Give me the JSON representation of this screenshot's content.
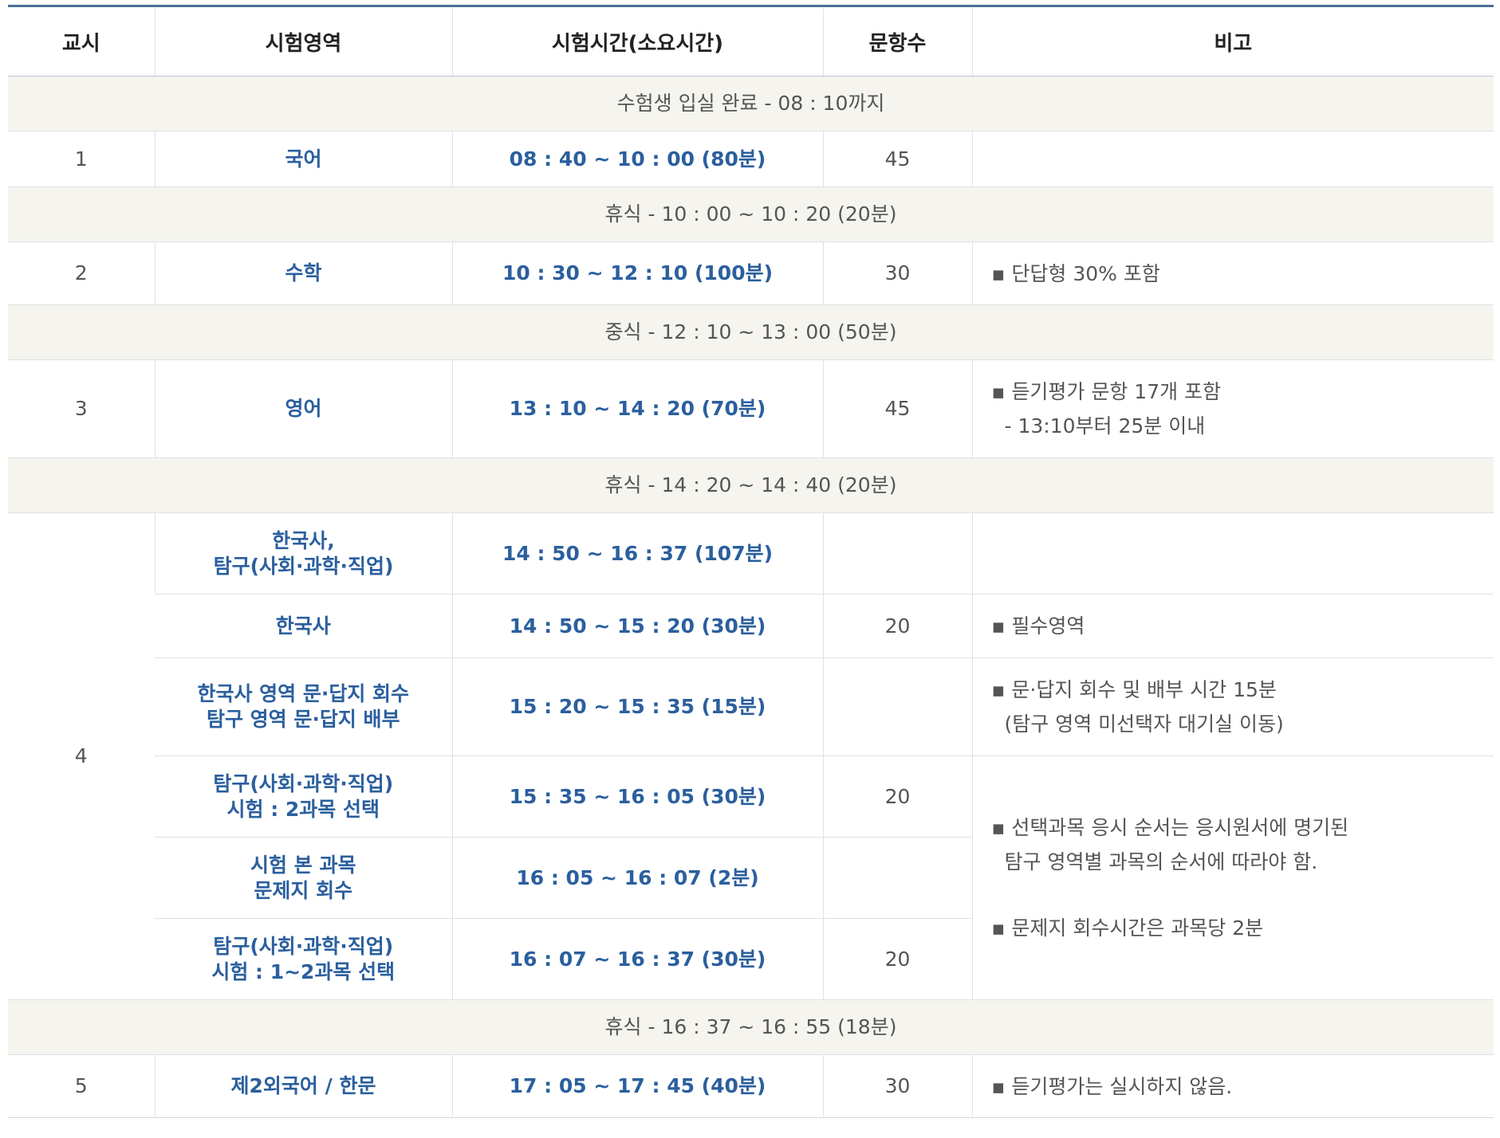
{
  "headers": [
    "교시",
    "시험영역",
    "시험시간(소요시간)",
    "문항수",
    "비고"
  ],
  "entry": "수험생 입실 완료 - 08 : 10까지",
  "p1": {
    "no": "1",
    "subject": "국어",
    "time": "08 : 40 ~ 10 : 00 (80분)",
    "count": "45",
    "note": ""
  },
  "break1": "휴식 - 10 : 00 ~ 10 : 20 (20분)",
  "p2": {
    "no": "2",
    "subject": "수학",
    "time": "10 : 30 ~ 12 : 10 (100분)",
    "count": "30",
    "note": "▪ 단답형 30% 포함"
  },
  "lunch": "중식 - 12 : 10 ~ 13 : 00 (50분)",
  "p3": {
    "no": "3",
    "subject": "영어",
    "time": "13 : 10 ~ 14 : 20 (70분)",
    "count": "45",
    "note1": "▪ 듣기평가 문항 17개 포함",
    "note2": "- 13:10부터 25분 이내"
  },
  "break2": "휴식 - 14 : 20 ~ 14 : 40 (20분)",
  "p4": {
    "no": "4",
    "r1": {
      "subject1": "한국사,",
      "subject2": "탐구(사회·과학·직업)",
      "time": "14 : 50 ~ 16 : 37 (107분)"
    },
    "r2": {
      "subject": "한국사",
      "time": "14 : 50 ~ 15 : 20 (30분)",
      "count": "20",
      "note": "▪ 필수영역"
    },
    "r3": {
      "subject1": "한국사 영역 문·답지 회수",
      "subject2": "탐구 영역 문·답지 배부",
      "time": "15 : 20 ~ 15 : 35 (15분)",
      "note1": "▪ 문·답지 회수 및 배부 시간 15분",
      "note2": "(탐구 영역 미선택자 대기실 이동)"
    },
    "r4": {
      "subject1": "탐구(사회·과학·직업)",
      "subject2": "시험 : 2과목 선택",
      "time": "15 : 35 ~ 16 : 05 (30분)",
      "count": "20"
    },
    "r5": {
      "subject1": "시험 본 과목",
      "subject2": "문제지 회수",
      "time": "16 : 05 ~ 16 : 07 (2분)"
    },
    "r6": {
      "subject1": "탐구(사회·과학·직업)",
      "subject2": "시험 : 1~2과목 선택",
      "time": "16 : 07 ~ 16 : 37 (30분)",
      "count": "20"
    },
    "note_a1": "▪ 선택과목 응시 순서는 응시원서에 명기된",
    "note_a2": "탐구 영역별 과목의 순서에 따라야 함.",
    "note_b": "▪ 문제지 회수시간은 과목당 2분"
  },
  "break3": "휴식 - 16 : 37 ~ 16 : 55 (18분)",
  "p5": {
    "no": "5",
    "subject": "제2외국어 / 한문",
    "time": "17 : 05 ~ 17 : 45 (40분)",
    "count": "30",
    "note": "▪ 듣기평가는 실시하지 않음."
  }
}
